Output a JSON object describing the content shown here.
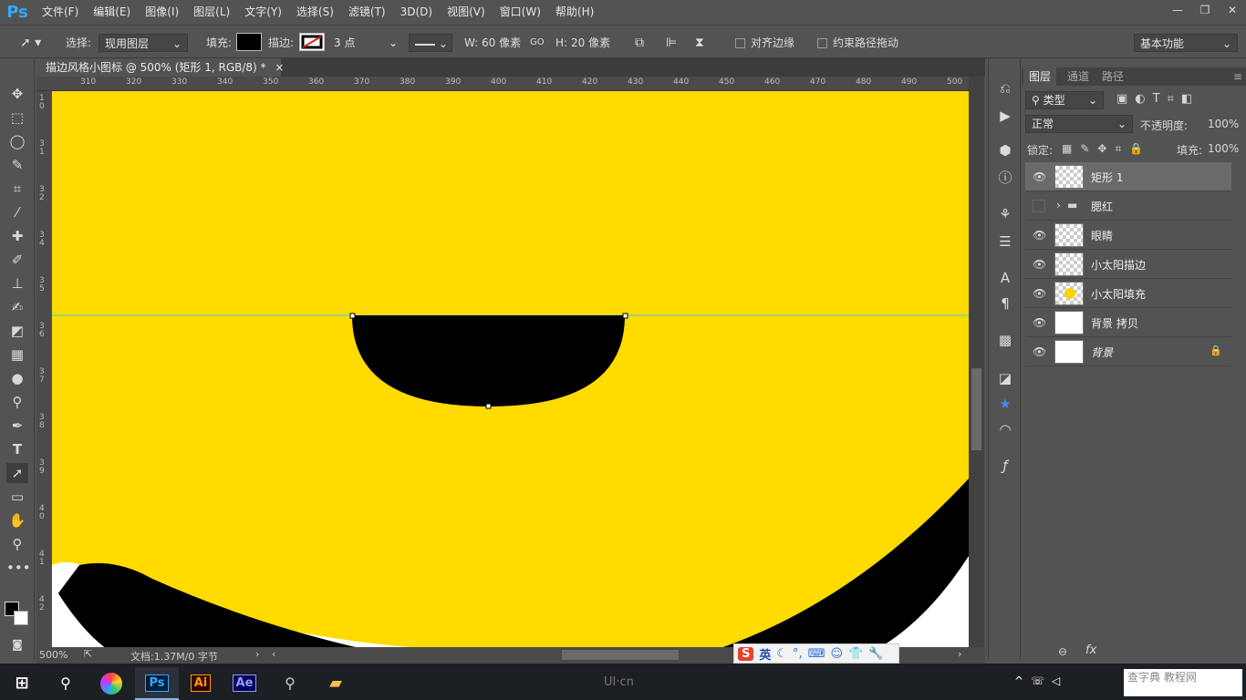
{
  "app": {
    "logo": "Ps",
    "menu": [
      "文件(F)",
      "编辑(E)",
      "图像(I)",
      "图层(L)",
      "文字(Y)",
      "选择(S)",
      "滤镜(T)",
      "3D(D)",
      "视图(V)",
      "窗口(W)",
      "帮助(H)"
    ],
    "window_controls": [
      "—",
      "❐",
      "✕"
    ]
  },
  "options": {
    "select_label": "选择:",
    "select_value": "现用图层",
    "fill_label": "填充:",
    "stroke_label": "描边:",
    "stroke_size": "3 点",
    "w_label": "W:",
    "w_value": "60 像素",
    "link_icon": "GO",
    "h_label": "H:",
    "h_value": "20 像素",
    "align_edges": "对齐边缘",
    "constrain_path": "约束路径拖动",
    "workspace": "基本功能",
    "fill_color": "#000000"
  },
  "document": {
    "tab_title": "描边风格小图标 @ 500% (矩形 1, RGB/8) *",
    "tab_close": "×",
    "canvas_color": "#ffdb00",
    "shape_color": "#000000",
    "guide_color": "#3cd5e0"
  },
  "ruler": {
    "top_ticks": [
      "310",
      "320",
      "330",
      "340",
      "350",
      "360",
      "370",
      "380",
      "390",
      "400",
      "410",
      "420",
      "430",
      "440",
      "450",
      "460",
      "470",
      "480",
      "490",
      "500"
    ],
    "left_ticks": [
      "1\n0",
      "3\n1",
      "3\n2",
      "3\n4",
      "3\n5",
      "3\n6",
      "3\n7",
      "3\n8",
      "3\n9",
      "4\n0",
      "4\n1",
      "4\n2"
    ]
  },
  "status": {
    "zoom": "500%",
    "doc_size": "文档:1.37M/0 字节"
  },
  "layers_panel": {
    "tabs": [
      "图层",
      "通道",
      "路径"
    ],
    "filter_label": "类型",
    "blend_mode": "正常",
    "opacity_label": "不透明度:",
    "opacity_value": "100%",
    "lock_label": "锁定:",
    "fill_label": "填充:",
    "fill_value": "100%",
    "layers": [
      {
        "name": "矩形 1",
        "visible": true,
        "selected": true,
        "type": "shape"
      },
      {
        "name": "腮红",
        "visible": false,
        "selected": false,
        "type": "group"
      },
      {
        "name": "眼睛",
        "visible": true,
        "selected": false,
        "type": "shape"
      },
      {
        "name": "小太阳描边",
        "visible": true,
        "selected": false,
        "type": "shape"
      },
      {
        "name": "小太阳填充",
        "visible": true,
        "selected": false,
        "type": "shape"
      },
      {
        "name": "背景 拷贝",
        "visible": true,
        "selected": false,
        "type": "white"
      },
      {
        "name": "背景",
        "visible": true,
        "selected": false,
        "type": "white",
        "locked": true
      }
    ]
  },
  "taskbar": {
    "apps": [
      "Ps",
      "Ai",
      "Ae"
    ],
    "watermark": "UI·cn",
    "ime_lang": "英",
    "site_watermark": "查字典 教程网"
  }
}
